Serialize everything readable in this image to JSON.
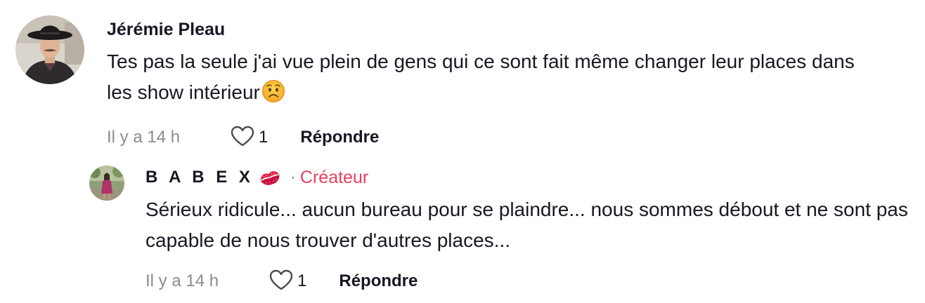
{
  "comments": [
    {
      "author": "Jérémie Pleau",
      "text": "Tes pas la seule j'ai vue plein de gens qui ce sont fait même changer leur places dans les show intérieur",
      "emoji": "worried-face",
      "time": "Il y a 14 h",
      "likes": "1",
      "reply_label": "Répondre"
    },
    {
      "author": "B A B E X",
      "author_emoji": "kiss-mark",
      "separator": "·",
      "badge": "Créateur",
      "text": "Sérieux ridicule... aucun bureau pour se plaindre... nous sommes débout et ne sont pas capable de nous trouver d'autres places...",
      "time": "Il y a 14 h",
      "likes": "1",
      "reply_label": "Répondre"
    }
  ],
  "colors": {
    "text": "#161823",
    "muted": "#8a8b91",
    "creator_badge": "#e8405f"
  },
  "icons": {
    "like": "heart-outline-icon",
    "worried": "worried-face-emoji",
    "kiss": "kiss-mark-emoji"
  }
}
